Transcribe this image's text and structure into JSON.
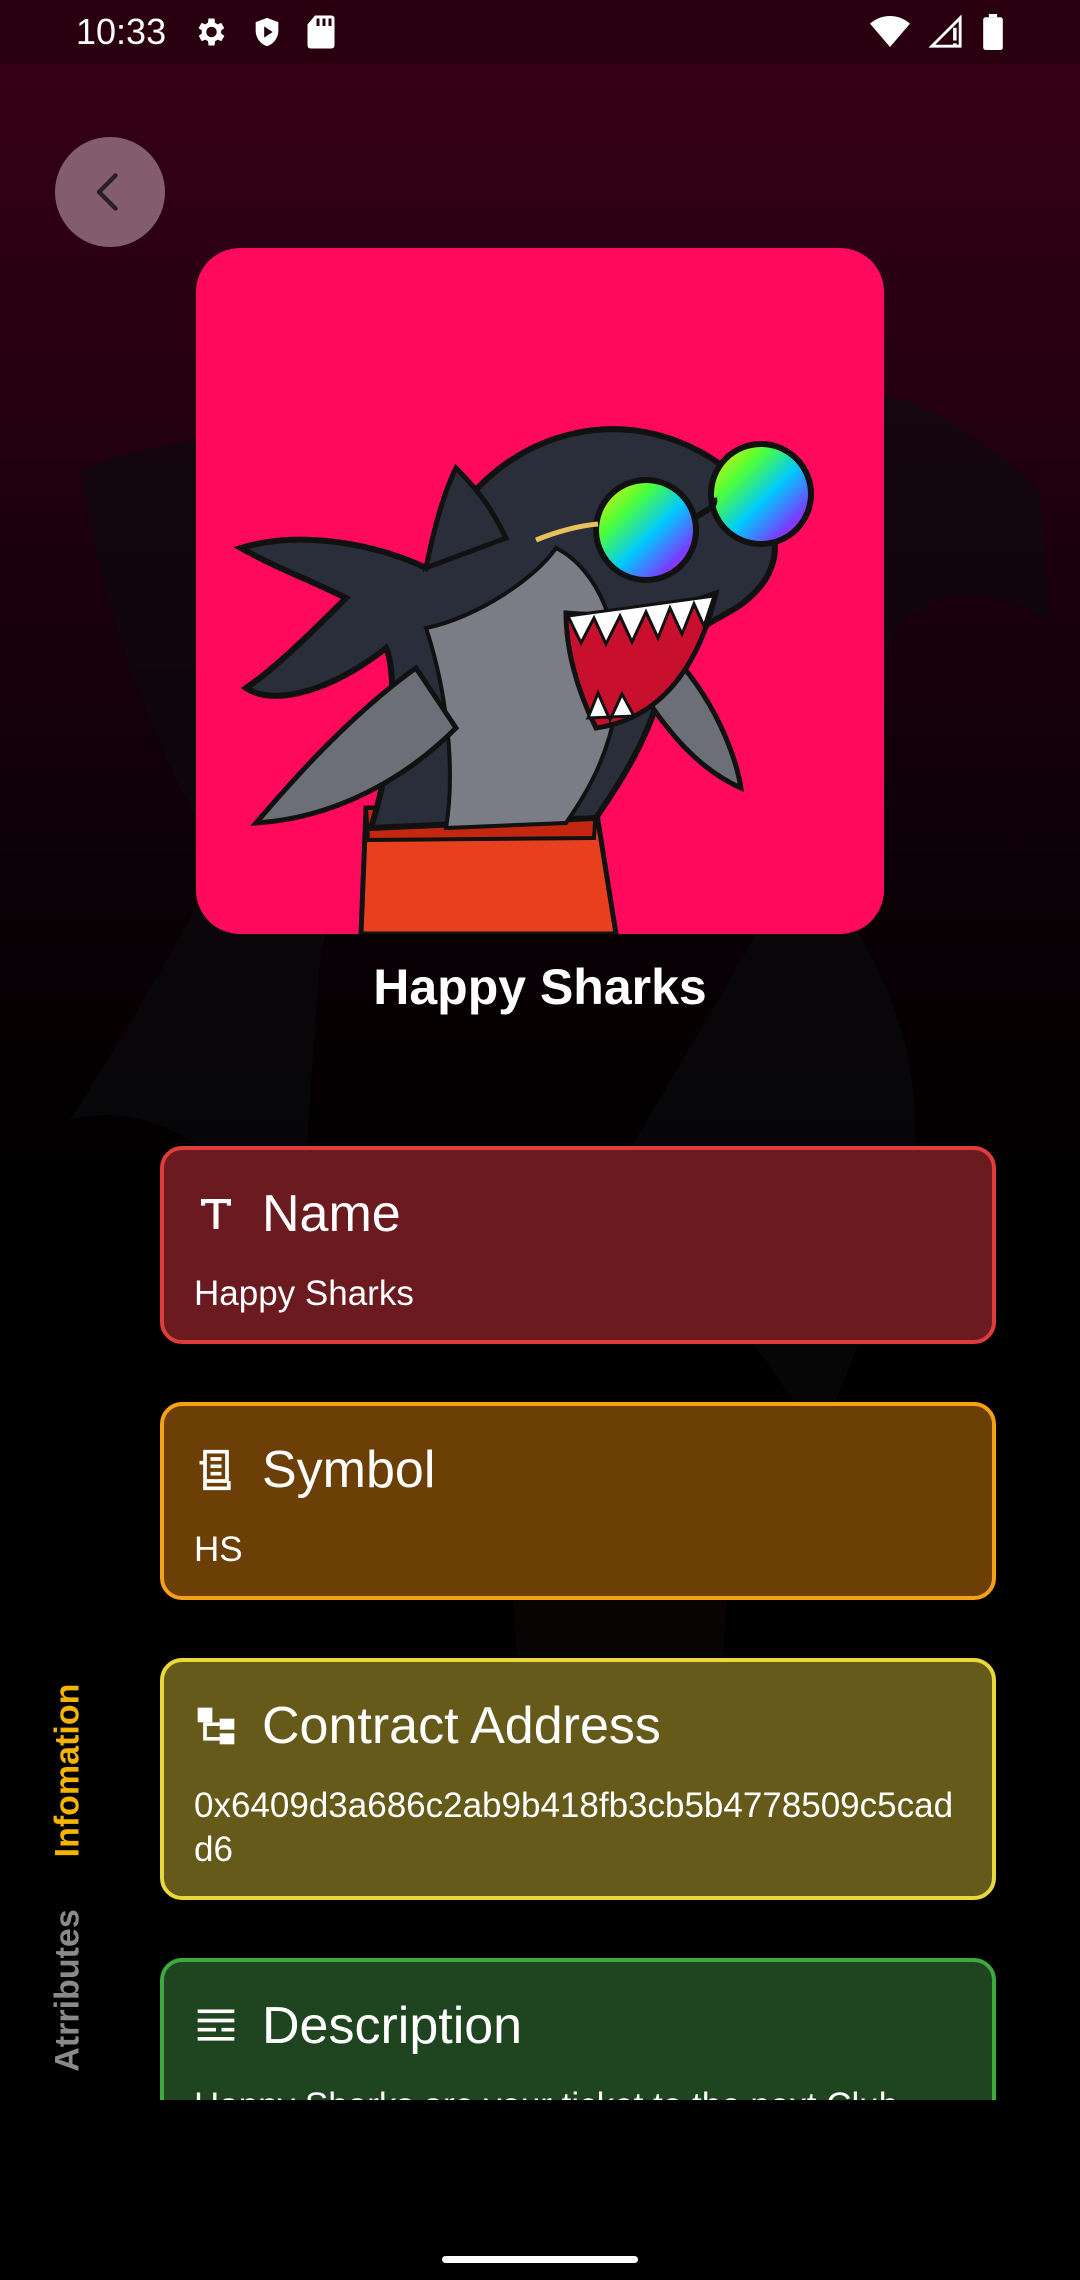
{
  "status_bar": {
    "time": "10:33",
    "left_icons": [
      "gear-icon",
      "shield-icon",
      "sd-card-icon"
    ],
    "right_icons": [
      "wifi-icon",
      "signal-icon",
      "battery-icon"
    ]
  },
  "header": {
    "back_icon": "chevron-left-icon"
  },
  "nft": {
    "title": "Happy Sharks",
    "image_bg_color": "#ff0a5c"
  },
  "side_tabs": [
    {
      "label": "Infomation",
      "active": true,
      "color": "#f5b400"
    },
    {
      "label": "Atrributes",
      "active": false,
      "color": "#8a8a8a"
    }
  ],
  "cards": {
    "name": {
      "icon": "text-icon",
      "label": "Name",
      "value": "Happy Sharks",
      "border": "#e03c3c",
      "bg": "#6b1a1f"
    },
    "symbol": {
      "icon": "receipt-icon",
      "label": "Symbol",
      "value": "HS",
      "border": "#f5a015",
      "bg": "#6b3f05"
    },
    "contract": {
      "icon": "hierarchy-icon",
      "label": "Contract Address",
      "value": "0x6409d3a686c2ab9b418fb3cb5b4778509c5cadd6",
      "border": "#e8d83c",
      "bg": "#655a1a"
    },
    "description": {
      "icon": "notes-icon",
      "label": "Description",
      "value": "Happy Sharks are your ticket to the next Club",
      "border": "#3caa3c",
      "bg": "#1f4520"
    }
  }
}
